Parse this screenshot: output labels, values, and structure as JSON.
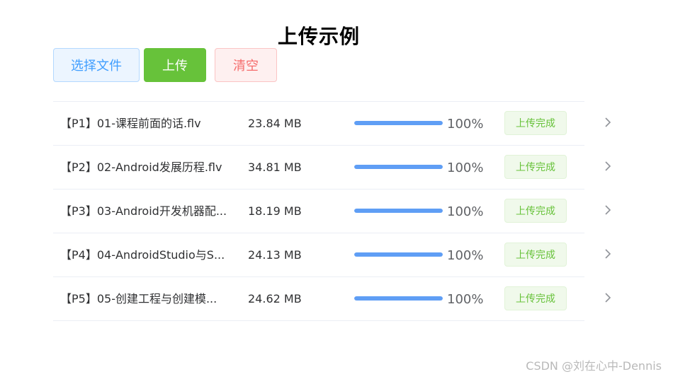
{
  "page": {
    "title": "上传示例"
  },
  "toolbar": {
    "select_label": "选择文件",
    "upload_label": "上传",
    "clear_label": "清空"
  },
  "files": [
    {
      "name": "【P1】01-课程前面的话.flv",
      "size": "23.84 MB",
      "progress": 100,
      "progress_text": "100%",
      "status": "上传完成"
    },
    {
      "name": "【P2】02-Android发展历程.flv",
      "size": "34.81 MB",
      "progress": 100,
      "progress_text": "100%",
      "status": "上传完成"
    },
    {
      "name": "【P3】03-Android开发机器配...",
      "size": "18.19 MB",
      "progress": 100,
      "progress_text": "100%",
      "status": "上传完成"
    },
    {
      "name": "【P4】04-AndroidStudio与S...",
      "size": "24.13 MB",
      "progress": 100,
      "progress_text": "100%",
      "status": "上传完成"
    },
    {
      "name": "【P5】05-创建工程与创建模...",
      "size": "24.62 MB",
      "progress": 100,
      "progress_text": "100%",
      "status": "上传完成"
    }
  ],
  "watermark": {
    "text": "CSDN @刘在心中-Dennis"
  },
  "icons": {
    "row_action": "chevron-right-icon"
  },
  "colors": {
    "primary": "#409eff",
    "success": "#67c23a",
    "danger": "#f56c6c",
    "progress_fill": "#5f9ef5"
  }
}
